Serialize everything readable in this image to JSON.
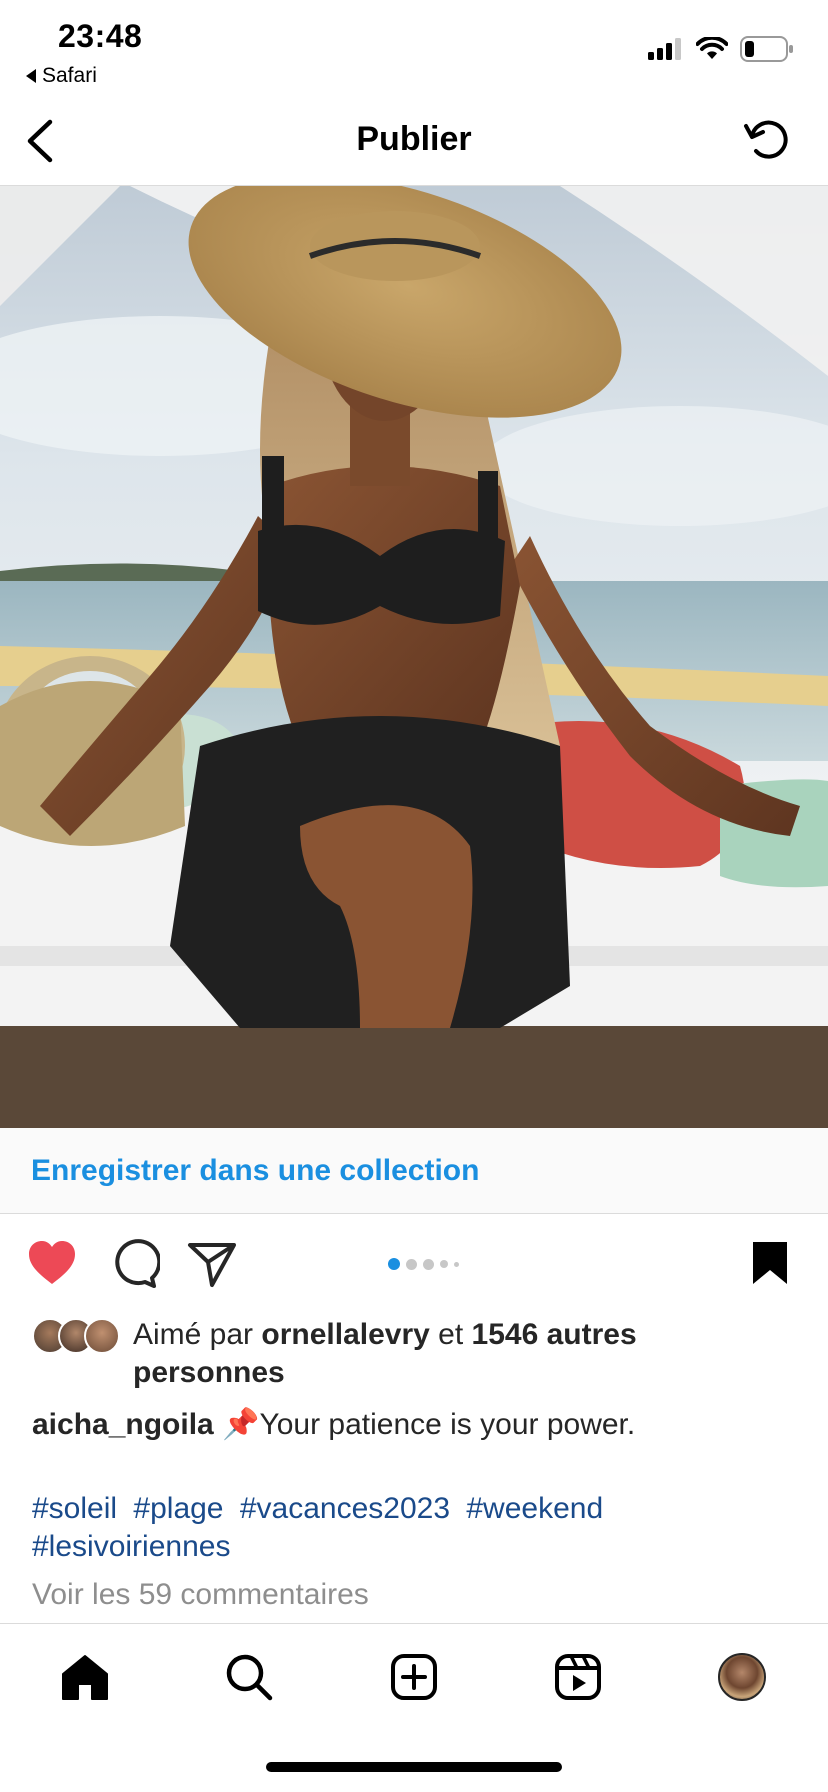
{
  "status_bar": {
    "time": "23:48",
    "back_app": "Safari"
  },
  "header": {
    "title": "Publier"
  },
  "collection": {
    "label": "Enregistrer dans une collection"
  },
  "carousel": {
    "total": 5,
    "active": 1
  },
  "likes": {
    "prefix": "Aimé par",
    "user": "ornellalevry",
    "connector": "et",
    "others": "1546 autres personnes"
  },
  "caption": {
    "username": "aicha_ngoila",
    "emoji": "📌",
    "text": "Your patience is your power."
  },
  "hashtags": [
    "#soleil",
    "#plage",
    "#vacances2023",
    "#weekend",
    "#lesivoiriennes"
  ],
  "comments": {
    "label": "Voir les 59 commentaires"
  },
  "colors": {
    "like": "#ed4956",
    "link": "#1a8fe0",
    "hashtag": "#1a4a8a"
  },
  "icons": [
    "signal-icon",
    "wifi-icon",
    "battery-icon",
    "back-chevron-icon",
    "refresh-icon",
    "heart-icon",
    "comment-icon",
    "share-icon",
    "bookmark-icon",
    "home-icon",
    "search-icon",
    "add-icon",
    "reels-icon"
  ]
}
